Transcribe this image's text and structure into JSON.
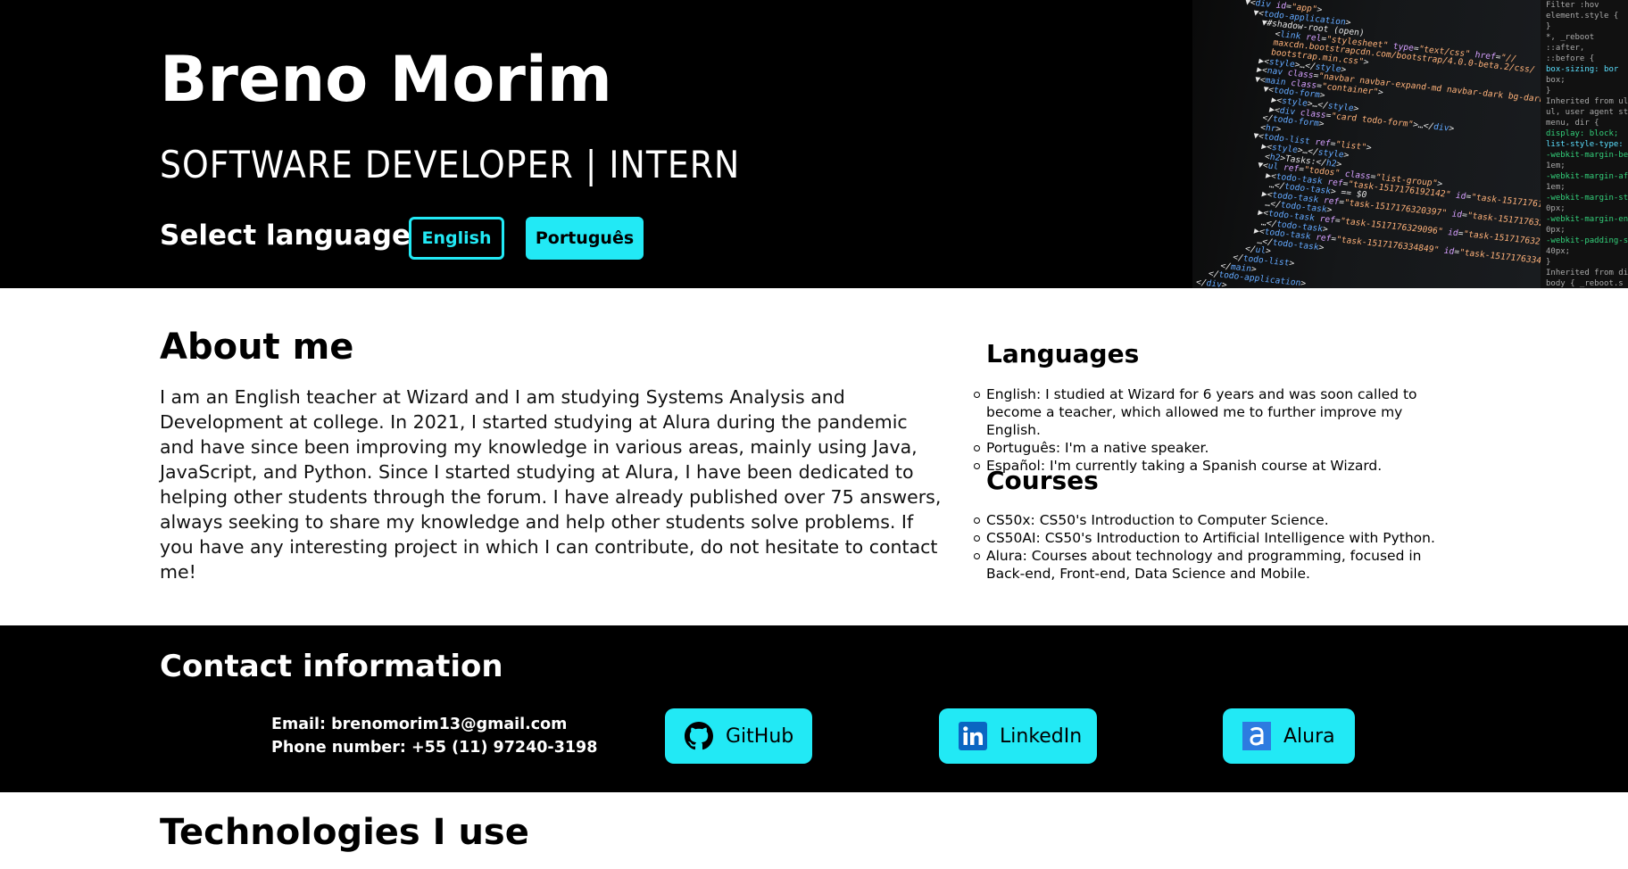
{
  "header": {
    "name": "Breno Morim",
    "role": "SOFTWARE DEVELOPER | INTERN",
    "select_language_label": "Select language:",
    "lang_buttons": [
      {
        "label": "English",
        "active": true
      },
      {
        "label": "Português",
        "active": false
      }
    ]
  },
  "about": {
    "title": "About me",
    "text": "I am an English teacher at Wizard and I am studying Systems Analysis and Development at college. In 2021, I started studying at Alura during the pandemic and have since been improving my knowledge in various areas, mainly using Java, JavaScript, and Python. Since I started studying at Alura, I have been dedicated to helping other students through the forum. I have already published over 75 answers, always seeking to share my knowledge and help other students solve problems. If you have any interesting project in which I can contribute, do not hesitate to contact me!"
  },
  "languages": {
    "title": "Languages",
    "items": [
      "English: I studied at Wizard for 6 years and was soon called to become a teacher, which allowed me to further improve my English.",
      "Português: I'm a native speaker.",
      "Español: I'm currently taking a Spanish course at Wizard."
    ]
  },
  "courses": {
    "title": "Courses",
    "items": [
      "CS50x: CS50's Introduction to Computer Science.",
      "CS50AI: CS50's Introduction to Artificial Intelligence with Python.",
      "Alura: Courses about technology and programming, focused in Back-end, Front-end, Data Science and Mobile."
    ]
  },
  "contact": {
    "title": "Contact information",
    "email": "Email: brenomorim13@gmail.com",
    "phone": "Phone number: +55 (11) 97240-3198",
    "links": [
      {
        "label": "GitHub",
        "icon": "github-icon"
      },
      {
        "label": "LinkedIn",
        "icon": "linkedin-icon"
      },
      {
        "label": "Alura",
        "icon": "alura-icon"
      }
    ]
  },
  "technologies": {
    "title": "Technologies I use"
  },
  "colors": {
    "accent": "#22e9f5",
    "dark": "#000000",
    "light": "#ffffff"
  }
}
